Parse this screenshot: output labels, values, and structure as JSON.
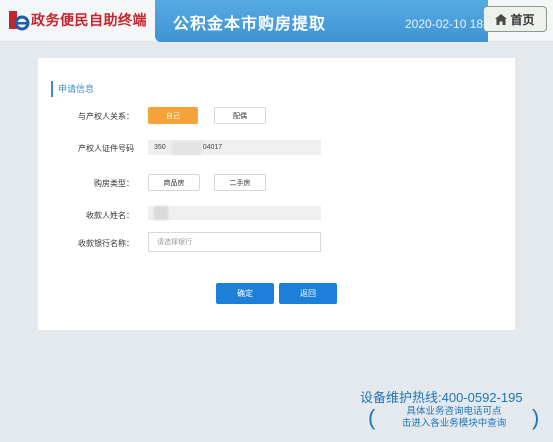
{
  "header": {
    "logo_text": "政务便民自助终端",
    "title": "公积金本市购房提取",
    "datetime": "2020-02-10 18:",
    "home_label": "首页"
  },
  "form": {
    "section_title": "申请信息",
    "relation": {
      "label": "与产权人关系：",
      "options": [
        "自己",
        "配偶"
      ],
      "selected": "自己"
    },
    "id_number": {
      "label": "产权人证件号码",
      "prefix": "350",
      "suffix": "04017"
    },
    "house_type": {
      "label": "购房类型：",
      "options": [
        "商品房",
        "二手房"
      ]
    },
    "payee_name": {
      "label": "收款人姓名："
    },
    "bank": {
      "label": "收款银行名称：",
      "placeholder": "请选择银行"
    },
    "confirm_label": "确定",
    "back_label": "返回"
  },
  "footer": {
    "hotline": "设备维护热线:400-0592-195",
    "hint_line1": "具体业务咨询电话可点",
    "hint_line2": "击进入各业务模块中查询"
  },
  "colors": {
    "accent_blue": "#1d80d8",
    "selected_orange": "#f6a43a",
    "logo_red": "#c5262c"
  }
}
